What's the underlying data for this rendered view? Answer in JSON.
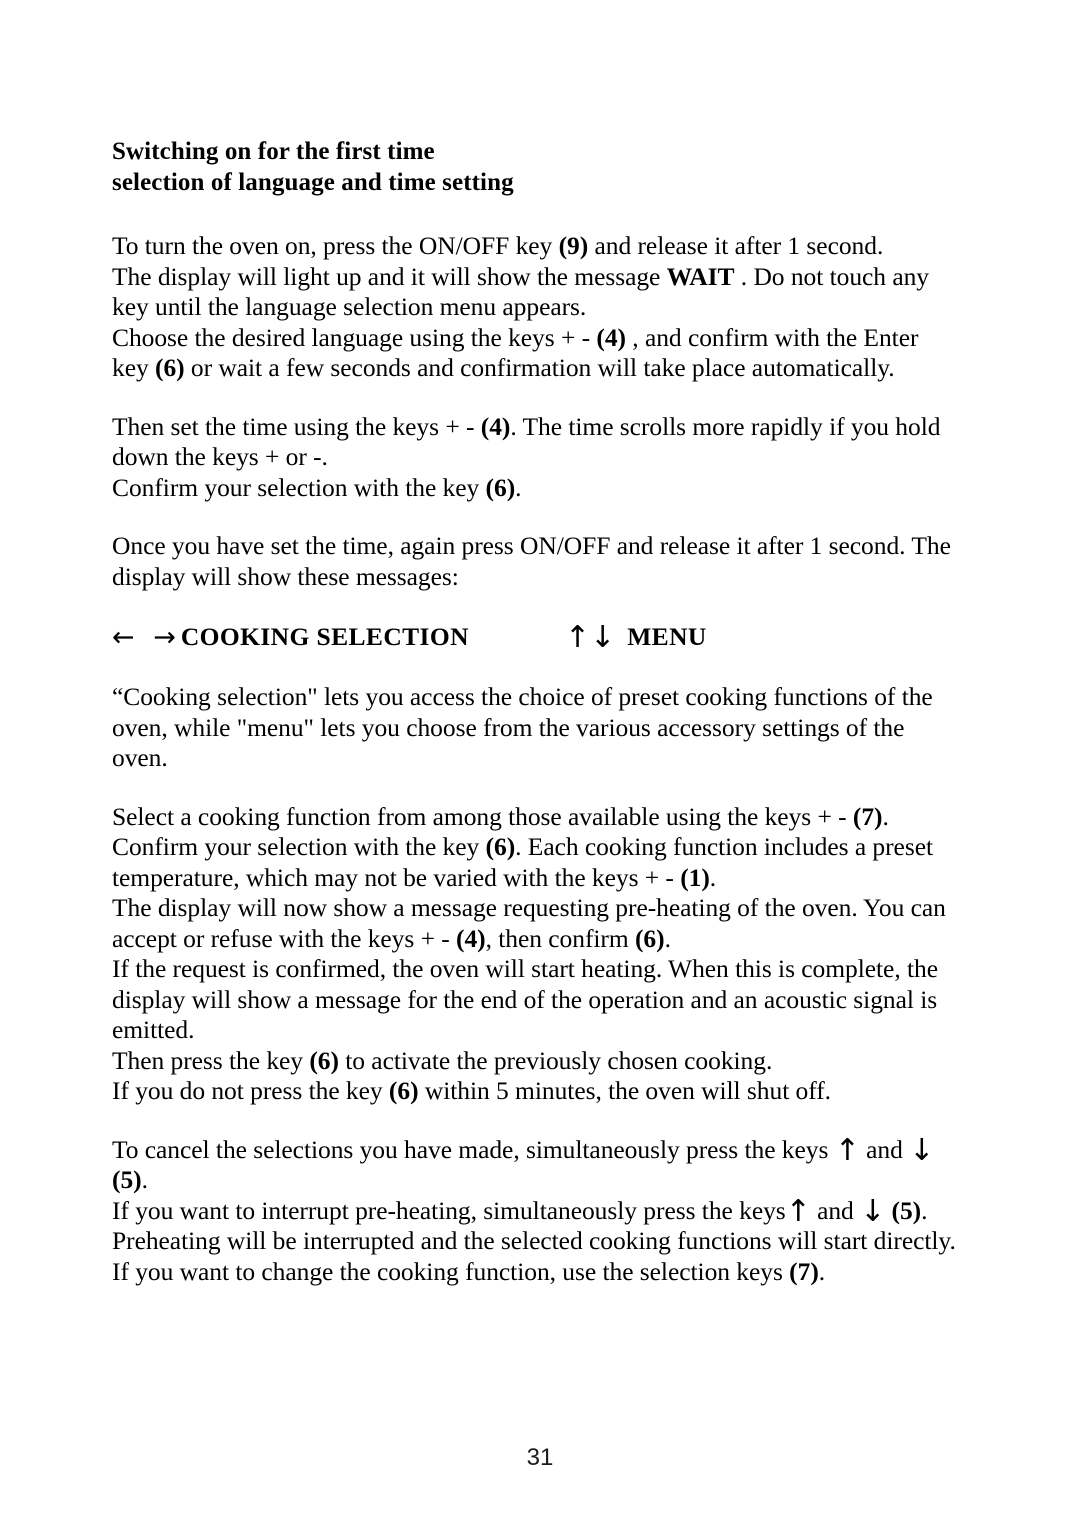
{
  "document": {
    "page_number": "31",
    "heading": {
      "line1": "Switching on for the first time",
      "line2": "selection of language and time setting"
    },
    "paragraphs": {
      "p1": {
        "l1a": "To turn the oven on, press the ON/OFF key ",
        "l1b": "(9)",
        "l1c": " and release it after 1 second.",
        "l2a": "The display will light up and it will show the message ",
        "l2b": "WAIT",
        "l2c": " . Do not touch any",
        "l3": "key until the language selection menu appears.",
        "l4a": "Choose the desired language using  the keys + - ",
        "l4b": "(4)",
        "l4c": " , and confirm with the Enter",
        "l5a": "key ",
        "l5b": "(6)",
        "l5c": " or wait a few seconds and confirmation will take place automatically."
      },
      "p2": {
        "l1a": "Then set the time using the keys + - ",
        "l1b": "(4)",
        "l1c": ". The time scrolls more rapidly if you hold",
        "l2": "down the keys + or -.",
        "l3a": "Confirm your selection with the key ",
        "l3b": "(6)",
        "l3c": "."
      },
      "p3": {
        "l1": "Once you have set the time, again press ON/OFF and release it after 1 second. The",
        "l2": "display will show these messages:"
      },
      "p4": {
        "l1": "“Cooking selection\" lets you access the choice of preset cooking functions of the",
        "l2": "oven, while \"menu\" lets you choose from the various accessory settings of the",
        "l3": "oven."
      },
      "p5": {
        "l1a": "Select a cooking function from among those available using the keys + - ",
        "l1b": "(7)",
        "l1c": ".",
        "l2a": "Confirm your selection with the key ",
        "l2b": "(6)",
        "l2c": ". Each cooking function includes a preset",
        "l3a": "temperature, which may not be varied with the keys + - ",
        "l3b": "(1)",
        "l3c": ".",
        "l4": "The display will now show a message requesting pre-heating of the oven. You can",
        "l5a": "accept or refuse with the keys + - ",
        "l5b": "(4)",
        "l5c": ", then confirm ",
        "l5d": "(6)",
        "l5e": ".",
        "l6": "If the request is confirmed, the oven will start heating. When this is complete, the",
        "l7": "display will show a message for the end of the operation and an acoustic signal is",
        "l8": "emitted.",
        "l9a": "Then press the key ",
        "l9b": "(6)",
        "l9c": " to activate the previously chosen cooking.",
        "l10a": "If you do not press the key ",
        "l10b": "(6)",
        "l10c": " within 5 minutes, the oven will shut off."
      },
      "p6": {
        "l1a": "To cancel the selections you have made, simultaneously press the keys ",
        "l1_arrow_up": "↑",
        "l1b": " and ",
        "l1_arrow_down": "↓",
        "l2a": "(5)",
        "l2b": ".",
        "l3a": "If you want to interrupt pre-heating, simultaneously press the keys",
        "l3_arrow_up": "↑",
        "l3b": " and ",
        "l3_arrow_down": "↓",
        "l3c": " ",
        "l3d": "(5)",
        "l3e": ".",
        "l4": "Preheating will be interrupted and the selected cooking functions will start directly.",
        "l5a": "If you want to change the cooking function, use the selection keys ",
        "l5b": "(7)",
        "l5c": "."
      }
    },
    "display_message_line": {
      "arrows_left_right": "← →",
      "label_cooking": "COOKING SELECTION",
      "arrows_up_down": "↑↓",
      "label_menu": "MENU"
    }
  }
}
